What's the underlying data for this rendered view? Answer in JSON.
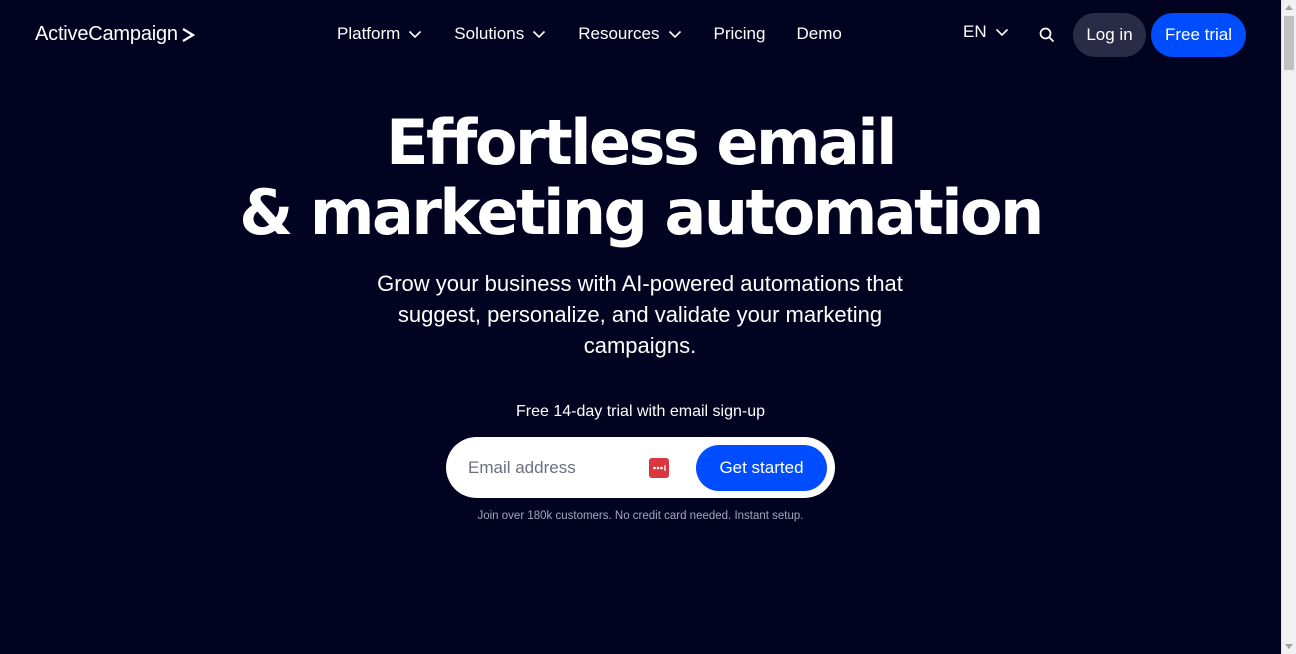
{
  "header": {
    "logo_text": "ActiveCampaign",
    "logo_chevron": ">",
    "nav": {
      "platform": "Platform",
      "solutions": "Solutions",
      "resources": "Resources",
      "pricing": "Pricing",
      "demo": "Demo"
    },
    "language": "EN",
    "login_label": "Log in",
    "free_trial_label": "Free trial"
  },
  "hero": {
    "title_line1": "Effortless email",
    "title_line2": "& marketing automation",
    "subtitle": "Grow your business with AI-powered automations that suggest, personalize, and validate your marketing campaigns.",
    "trial_note": "Free 14-day trial with email sign-up",
    "email_placeholder": "Email address",
    "cta_label": "Get started",
    "fine_print": "Join over 180k customers. No credit card needed. Instant setup."
  },
  "colors": {
    "background": "#020321",
    "accent": "#004cff",
    "login_bg": "#2a2b47",
    "password_manager_icon": "#d9363e"
  },
  "icons": {
    "nav_caret": "chevron-down-icon",
    "search": "search-icon",
    "password_manager": "password-manager-icon"
  }
}
